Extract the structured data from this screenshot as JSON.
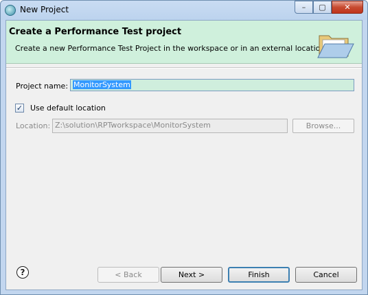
{
  "window": {
    "title": "New Project",
    "minimize_glyph": "–",
    "maximize_glyph": "▢",
    "close_glyph": "✕"
  },
  "banner": {
    "title": "Create a Performance Test project",
    "description": "Create a new Performance Test Project in the workspace or in an external location.",
    "icon": "open-folder-icon"
  },
  "form": {
    "project_name_label": "Project name:",
    "project_name_value": "MonitorSystem",
    "use_default_location_label": "Use default location",
    "use_default_location_checked": true,
    "location_label": "Location:",
    "location_value": "Z:\\solution\\RPTworkspace\\MonitorSystem",
    "browse_label": "Browse..."
  },
  "buttons": {
    "help_glyph": "?",
    "back": "< Back",
    "next": "Next >",
    "finish": "Finish",
    "cancel": "Cancel"
  },
  "colors": {
    "banner_bg": "#cff0dc",
    "selection": "#3399ff",
    "default_button_border": "#3c7fb1"
  }
}
